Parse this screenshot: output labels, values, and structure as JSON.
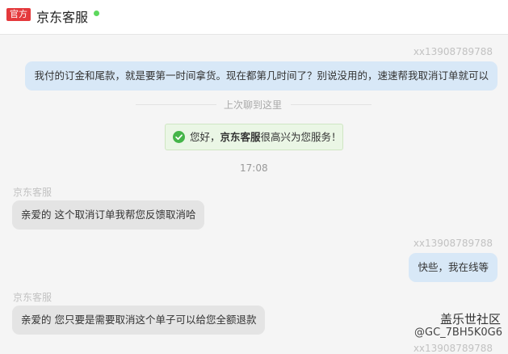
{
  "header": {
    "badge": "官方",
    "title": "京东客服",
    "status_color": "#5dd85d"
  },
  "messages": {
    "m1": {
      "sender": "xx13908789788",
      "text": "我付的订金和尾款，就是要第一时间拿货。现在都第几时间了？别说没用的，速速帮我取消订单就可以"
    },
    "divider": "上次聊到这里",
    "notice": {
      "pre": "您好，",
      "bold": "京东客服",
      "post": "很高兴为您服务！",
      "icon": "check-circle-icon"
    },
    "time": "17:08",
    "m2": {
      "sender": "京东客服",
      "text": "亲爱的 这个取消订单我帮您反馈取消哈"
    },
    "m3": {
      "sender": "xx13908789788",
      "text": "快些，我在线等"
    },
    "m4": {
      "sender": "京东客服",
      "text": "亲爱的 您只要是需要取消这个单子可以给您全额退款"
    },
    "m5": {
      "sender": "xx13908789788"
    }
  },
  "watermark": {
    "line1": "盖乐世社区",
    "line2": "@GC_7BH5K0G6"
  },
  "colors": {
    "my_bubble": "#d8e8f7",
    "their_bubble": "#e4e4e4",
    "badge": "#e4393c"
  }
}
